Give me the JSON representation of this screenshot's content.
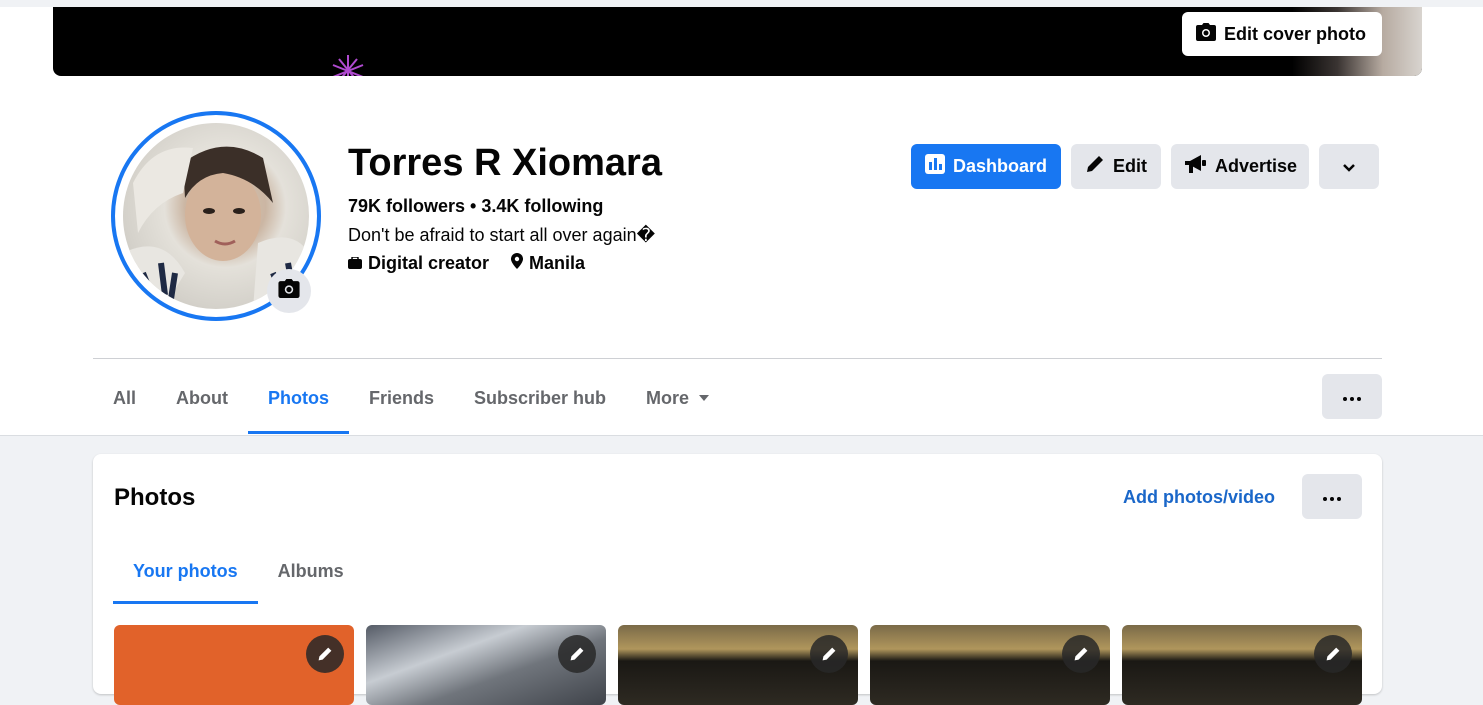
{
  "cover": {
    "edit_label": "Edit cover photo"
  },
  "profile": {
    "name": "Torres R Xiomara",
    "stats": "79K followers • 3.4K following",
    "bio": "Don't be afraid to start all over again�",
    "category": "Digital creator",
    "location": "Manila"
  },
  "actions": {
    "dashboard": "Dashboard",
    "edit": "Edit",
    "advertise": "Advertise"
  },
  "tabs": [
    {
      "label": "All"
    },
    {
      "label": "About"
    },
    {
      "label": "Photos",
      "active": true
    },
    {
      "label": "Friends"
    },
    {
      "label": "Subscriber hub"
    },
    {
      "label": "More"
    }
  ],
  "photos": {
    "title": "Photos",
    "add_label": "Add photos/video",
    "subtabs": [
      {
        "label": "Your photos",
        "active": true
      },
      {
        "label": "Albums"
      }
    ]
  },
  "colors": {
    "accent": "#1877f2",
    "link": "#1a67c9",
    "button_gray": "#e4e6eb"
  }
}
